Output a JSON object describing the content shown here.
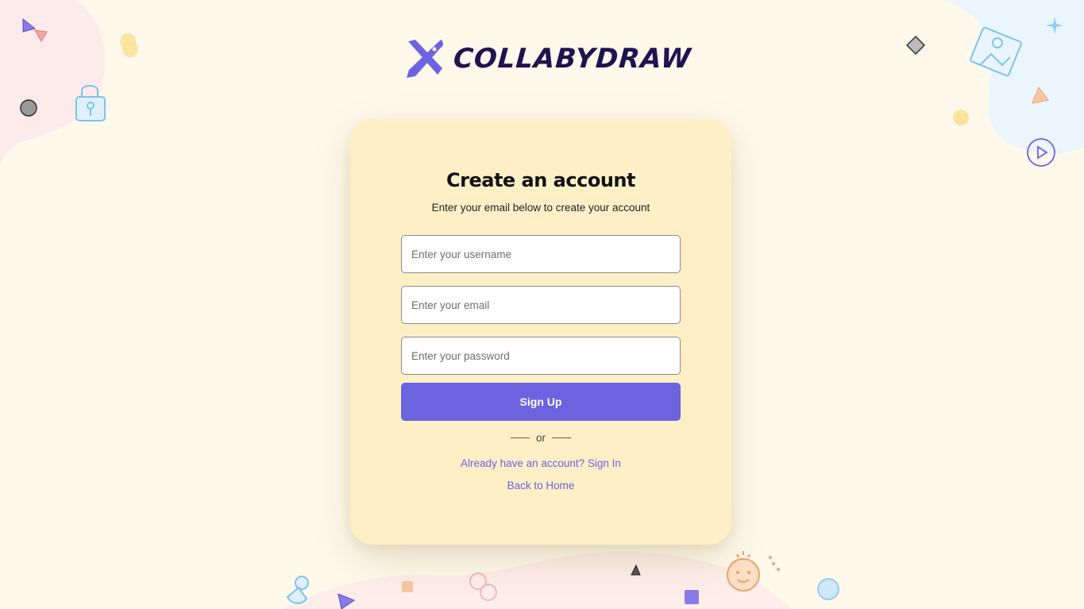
{
  "brand": {
    "name": "COLLABYDRAW"
  },
  "form": {
    "title": "Create an account",
    "subtitle": "Enter your email below to create your account",
    "username_placeholder": "Enter your username",
    "email_placeholder": "Enter your email",
    "password_placeholder": "Enter your password",
    "submit_label": "Sign Up",
    "divider_text": "or",
    "signin_link": "Already have an account? Sign In",
    "home_link": "Back to Home"
  },
  "colors": {
    "background": "#fff9ec",
    "card": "#ffefc6",
    "accent": "#6c63e0",
    "brand_text": "#1e1450"
  }
}
